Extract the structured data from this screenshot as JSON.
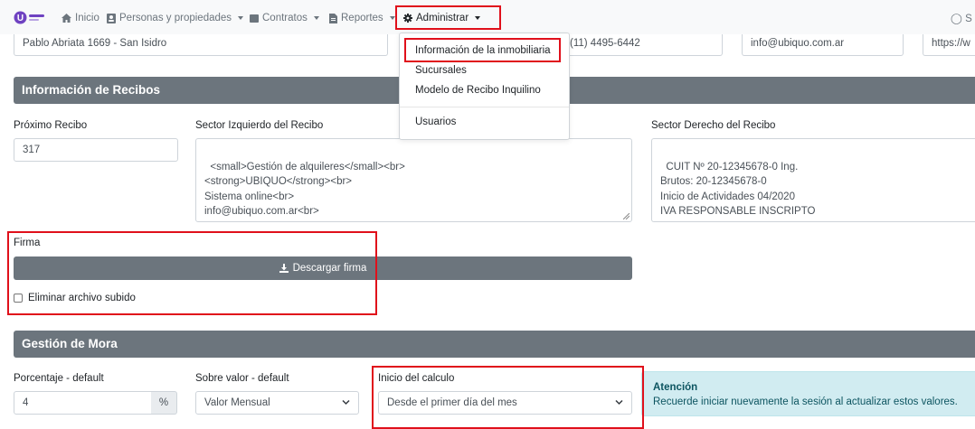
{
  "colors": {
    "highlight": "#e0101b",
    "section_header": "#6c757d",
    "alert_bg": "#d1ecf1",
    "logo": "#6f42c1"
  },
  "navbar": {
    "logo_icon": "ubiquo-logo",
    "items": [
      {
        "label": "Inicio",
        "icon": "home-icon"
      },
      {
        "label": "Personas y propiedades",
        "icon": "person-card-icon"
      },
      {
        "label": "Contratos",
        "icon": "folder-icon"
      },
      {
        "label": "Reportes",
        "icon": "document-icon"
      },
      {
        "label": "Administrar",
        "icon": "gear-icon"
      }
    ],
    "right_label": "S"
  },
  "top_row": {
    "address": "Pablo Abriata 1669 - San Isidro",
    "phone": "(11) 4495-6442",
    "email": "info@ubiquo.com.ar",
    "website": "https://w"
  },
  "dropdown": {
    "items": [
      "Información de la inmobiliaria",
      "Sucursales",
      "Modelo de Recibo Inquilino",
      "Usuarios"
    ]
  },
  "recibos": {
    "header": "Información de Recibos",
    "proximo_label": "Próximo Recibo",
    "proximo_value": "317",
    "izq_label": "Sector Izquierdo del Recibo",
    "izq_value": "<small>Gestión de alquileres</small><br>\n<strong>UBIQUO</strong><br>\nSistema online<br>\ninfo@ubiquo.com.ar<br>\nwww.ubiquo.com.ar",
    "der_label": "Sector Derecho del Recibo",
    "der_value": "CUIT Nº 20-12345678-0 Ing.\nBrutos: 20-12345678-0\nInicio de Actividades 04/2020\nIVA RESPONSABLE INSCRIPTO"
  },
  "firma": {
    "label": "Firma",
    "download_button": "Descargar firma",
    "delete_checkbox": "Eliminar archivo subido"
  },
  "mora": {
    "header": "Gestión de Mora",
    "porcentaje_label": "Porcentaje - default",
    "porcentaje_value": "4",
    "porcentaje_addon": "%",
    "sobre_label": "Sobre valor - default",
    "sobre_value": "Valor Mensual",
    "inicio_label": "Inicio del calculo",
    "inicio_value": "Desde el primer día del mes",
    "alert_title": "Atención",
    "alert_text": "Recuerde iniciar nuevamente la sesión al actualizar estos valores."
  }
}
